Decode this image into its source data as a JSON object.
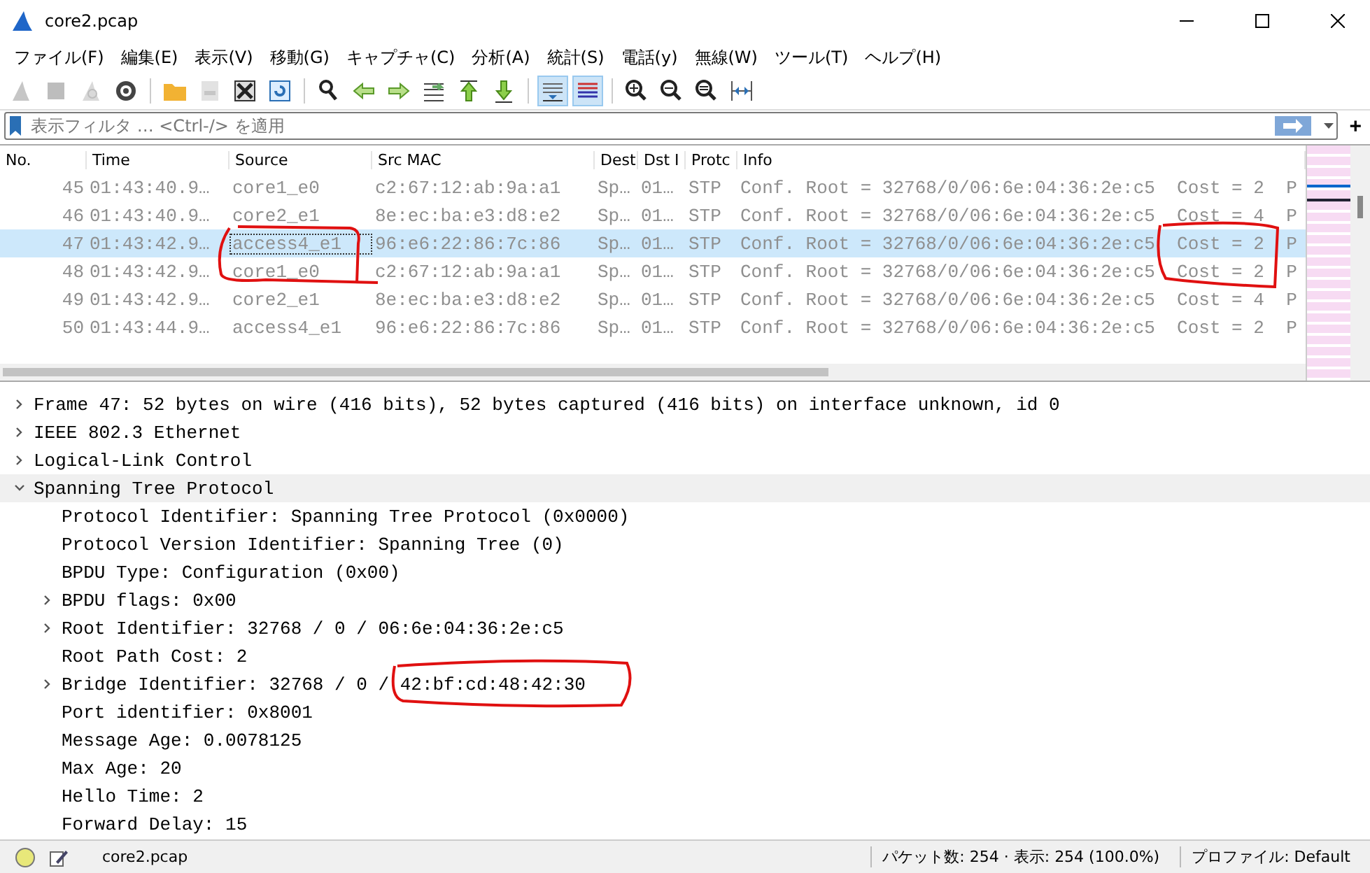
{
  "window": {
    "title": "core2.pcap"
  },
  "menu": [
    "ファイル(F)",
    "編集(E)",
    "表示(V)",
    "移動(G)",
    "キャプチャ(C)",
    "分析(A)",
    "統計(S)",
    "電話(y)",
    "無線(W)",
    "ツール(T)",
    "ヘルプ(H)"
  ],
  "toolbar": [
    {
      "disabled": true,
      "selected": false
    },
    {
      "disabled": true,
      "selected": false
    },
    {
      "disabled": true,
      "selected": false
    },
    {
      "disabled": false,
      "selected": false
    },
    {
      "disabled": false,
      "selected": false
    },
    {
      "disabled": true,
      "selected": false
    },
    {
      "disabled": false,
      "selected": false
    },
    {
      "disabled": false,
      "selected": false
    },
    {
      "disabled": false,
      "selected": false
    },
    {
      "disabled": false,
      "selected": false
    },
    {
      "disabled": false,
      "selected": false
    },
    {
      "disabled": false,
      "selected": false
    },
    {
      "disabled": false,
      "selected": false
    },
    {
      "disabled": false,
      "selected": false
    },
    {
      "disabled": false,
      "selected": true
    },
    {
      "disabled": false,
      "selected": true
    },
    {
      "disabled": false,
      "selected": false
    },
    {
      "disabled": false,
      "selected": false
    },
    {
      "disabled": false,
      "selected": false
    },
    {
      "disabled": false,
      "selected": false
    }
  ],
  "filter": {
    "placeholder": "表示フィルタ … <Ctrl-/> を適用",
    "add_button": "+"
  },
  "packet_list": {
    "columns": [
      "No.",
      "Time",
      "Source",
      "Src MAC",
      "Dest",
      "Dst I",
      "Protc",
      "Info"
    ],
    "rows": [
      {
        "no": "45",
        "time": "01:43:40.9…",
        "source": "core1_e0",
        "src_mac": "c2:67:12:ab:9a:a1",
        "dest": "Sp…",
        "dst": "01…",
        "protocol": "STP",
        "info": "Conf. Root = 32768/0/06:6e:04:36:2e:c5  Cost = 2  P",
        "selected": false
      },
      {
        "no": "46",
        "time": "01:43:40.9…",
        "source": "core2_e1",
        "src_mac": "8e:ec:ba:e3:d8:e2",
        "dest": "Sp…",
        "dst": "01…",
        "protocol": "STP",
        "info": "Conf. Root = 32768/0/06:6e:04:36:2e:c5  Cost = 4  P",
        "selected": false
      },
      {
        "no": "47",
        "time": "01:43:42.9…",
        "source": "access4_e1",
        "src_mac": "96:e6:22:86:7c:86",
        "dest": "Sp…",
        "dst": "01…",
        "protocol": "STP",
        "info": "Conf. Root = 32768/0/06:6e:04:36:2e:c5  Cost = 2  P",
        "selected": true
      },
      {
        "no": "48",
        "time": "01:43:42.9…",
        "source": "core1_e0",
        "src_mac": "c2:67:12:ab:9a:a1",
        "dest": "Sp…",
        "dst": "01…",
        "protocol": "STP",
        "info": "Conf. Root = 32768/0/06:6e:04:36:2e:c5  Cost = 2  P",
        "selected": false
      },
      {
        "no": "49",
        "time": "01:43:42.9…",
        "source": "core2_e1",
        "src_mac": "8e:ec:ba:e3:d8:e2",
        "dest": "Sp…",
        "dst": "01…",
        "protocol": "STP",
        "info": "Conf. Root = 32768/0/06:6e:04:36:2e:c5  Cost = 4  P",
        "selected": false
      },
      {
        "no": "50",
        "time": "01:43:44.9…",
        "source": "access4_e1",
        "src_mac": "96:e6:22:86:7c:86",
        "dest": "Sp…",
        "dst": "01…",
        "protocol": "STP",
        "info": "Conf. Root = 32768/0/06:6e:04:36:2e:c5  Cost = 2  P",
        "selected": false
      }
    ]
  },
  "details": [
    {
      "label": "Frame 47: 52 bytes on wire (416 bits), 52 bytes captured (416 bits) on interface unknown, id 0",
      "expanded": false,
      "selected": false
    },
    {
      "label": "IEEE 802.3 Ethernet",
      "expanded": false,
      "selected": false
    },
    {
      "label": "Logical-Link Control",
      "expanded": false,
      "selected": false
    },
    {
      "label": "Spanning Tree Protocol",
      "expanded": true,
      "selected": true,
      "children": [
        {
          "label": "Protocol Identifier: Spanning Tree Protocol (0x0000)"
        },
        {
          "label": "Protocol Version Identifier: Spanning Tree (0)"
        },
        {
          "label": "BPDU Type: Configuration (0x00)"
        },
        {
          "label": "BPDU flags: 0x00",
          "expanded": false
        },
        {
          "label": "Root Identifier: 32768 / 0 / 06:6e:04:36:2e:c5",
          "expanded": false
        },
        {
          "label": "Root Path Cost: 2"
        },
        {
          "label": "Bridge Identifier: 32768 / 0 / 42:bf:cd:48:42:30",
          "expanded": false
        },
        {
          "label": "Port identifier: 0x8001"
        },
        {
          "label": "Message Age: 0.0078125"
        },
        {
          "label": "Max Age: 20"
        },
        {
          "label": "Hello Time: 2"
        },
        {
          "label": "Forward Delay: 15"
        }
      ]
    }
  ],
  "status_bar": {
    "file": "core2.pcap",
    "packets": "パケット数: 254 · 表示: 254 (100.0%)",
    "profile": "プロファイル: Default"
  }
}
